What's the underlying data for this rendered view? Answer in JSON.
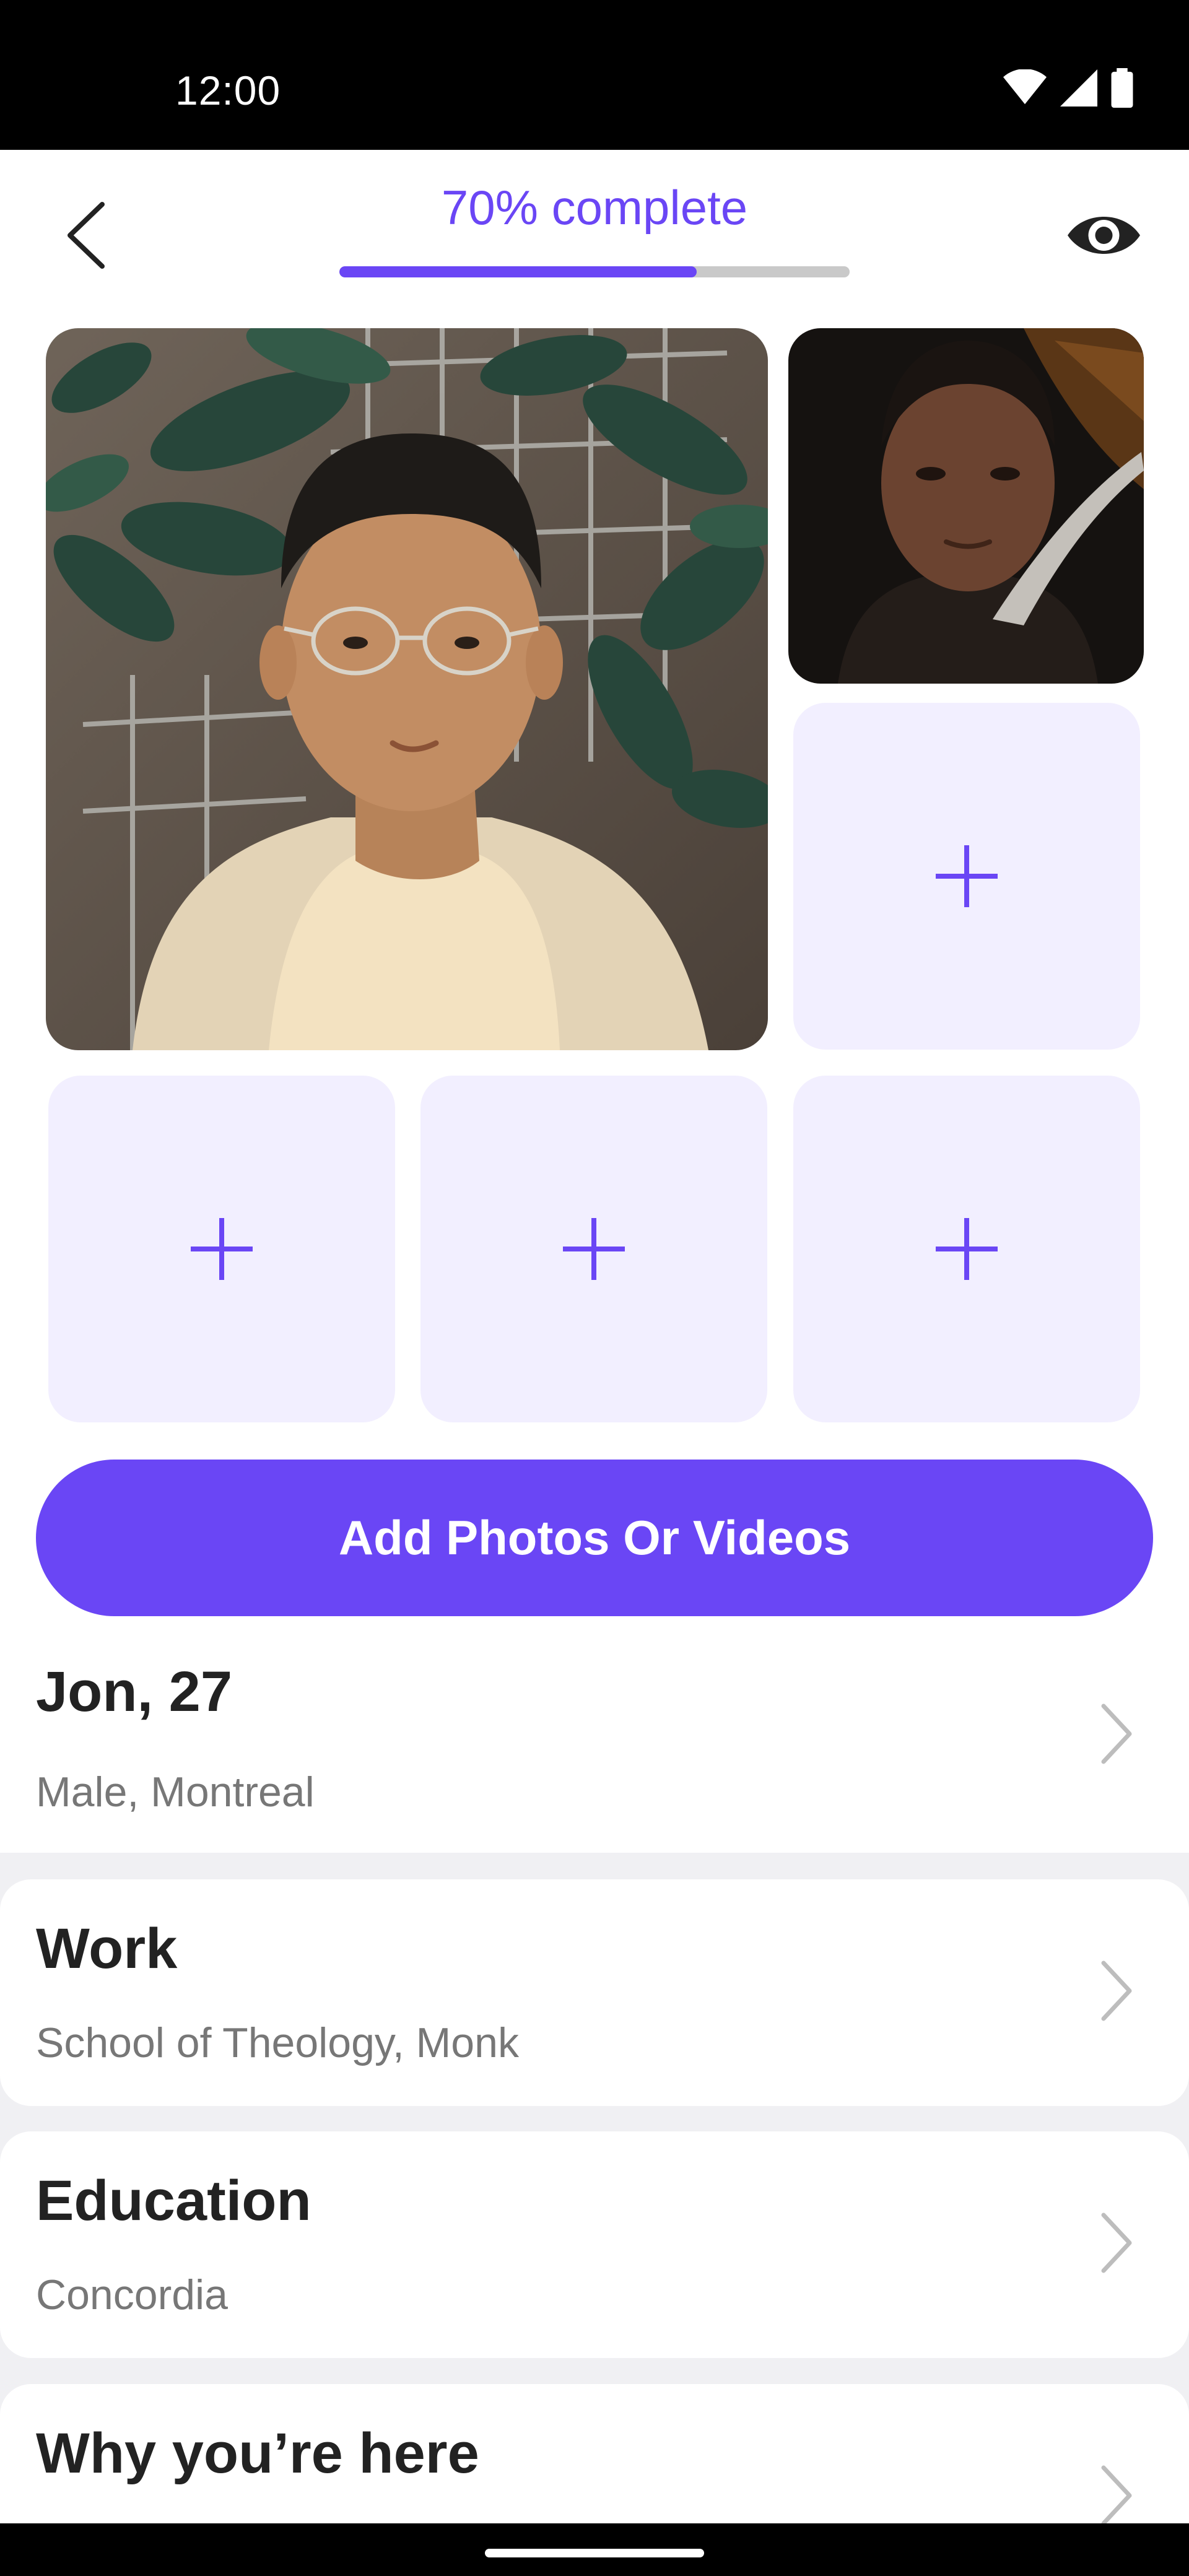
{
  "status_bar": {
    "time": "12:00"
  },
  "header": {
    "progress_label": "70% complete",
    "progress_fraction": 0.7
  },
  "photos": {
    "add_slots": 4
  },
  "cta": {
    "label": "Add Photos Or Videos"
  },
  "profile": {
    "name_age": "Jon, 27",
    "details": "Male, Montreal"
  },
  "sections": [
    {
      "title": "Work",
      "value": "School of Theology, Monk"
    },
    {
      "title": "Education",
      "value": "Concordia"
    },
    {
      "title": "Why you’re here",
      "value": ""
    }
  ],
  "colors": {
    "accent": "#6a46f5",
    "slot_bg": "#f2efff"
  }
}
